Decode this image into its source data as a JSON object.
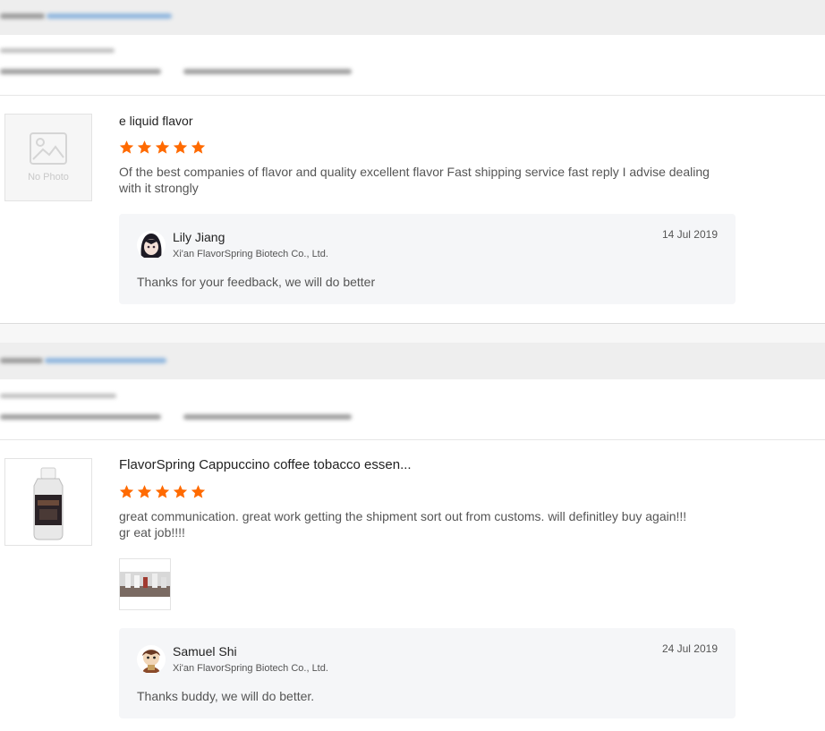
{
  "reviews": [
    {
      "product": {
        "title": "e liquid flavor",
        "image_placeholder": "No Photo"
      },
      "rating": 5,
      "text": "Of the best companies of flavor and quality excellent flavor Fast shipping service fast reply I advise dealing with it strongly",
      "reply": {
        "name": "Lily Jiang",
        "company": "Xi'an FlavorSpring Biotech Co., Ltd.",
        "date": "14 Jul 2019",
        "text": "Thanks for your feedback,  we will do better"
      }
    },
    {
      "product": {
        "title": "FlavorSpring Cappuccino coffee tobacco essen..."
      },
      "rating": 5,
      "text": "great communication. great work getting the shipment sort out from customs. will definitley buy again!!! gr eat job!!!!",
      "has_attached_photo": true,
      "reply": {
        "name": "Samuel Shi",
        "company": "Xi'an FlavorSpring Biotech Co., Ltd.",
        "date": "24 Jul 2019",
        "text": "Thanks buddy,  we will do better."
      }
    }
  ],
  "colors": {
    "star": "#ff6a00",
    "header_bar": "#eeeeee",
    "reply_bg": "#f5f6f8"
  },
  "icons": [
    "star-icon",
    "no-photo-icon",
    "avatar"
  ]
}
